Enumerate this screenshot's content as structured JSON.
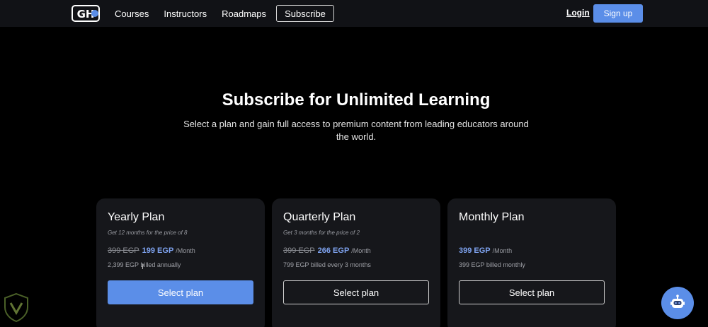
{
  "nav": {
    "logo_text": "GH",
    "links": [
      "Courses",
      "Instructors",
      "Roadmaps"
    ],
    "subscribe_label": "Subscribe",
    "login_label": "Login",
    "signup_label": "Sign up"
  },
  "hero": {
    "title": "Subscribe for Unlimited Learning",
    "subtitle": "Select a plan and gain full access to premium content from leading educators around the world."
  },
  "plans": [
    {
      "title": "Yearly Plan",
      "tagline": "Get 12 months for the price of 8",
      "old_price": "399 EGP",
      "new_price": "199 EGP",
      "unit": "/Month",
      "billed": "2,399 EGP billed annually",
      "button": "Select plan"
    },
    {
      "title": "Quarterly Plan",
      "tagline": "Get 3 months for the price of 2",
      "old_price": "399 EGP",
      "new_price": "266 EGP",
      "unit": "/Month",
      "billed": "799 EGP billed every 3 months",
      "button": "Select plan"
    },
    {
      "title": "Monthly Plan",
      "tagline": "",
      "old_price": "",
      "new_price": "399 EGP",
      "unit": "/Month",
      "billed": "399 EGP billed monthly",
      "button": "Select plan"
    }
  ],
  "colors": {
    "accent": "#5b8ee8",
    "price_highlight": "#7ea2ee",
    "card_bg": "#16171b",
    "nav_bg": "#111216",
    "page_bg": "#000000"
  },
  "icons": {
    "logo": "gh-logo-icon",
    "chat": "robot-chat-icon",
    "watermark": "shield-watermark-icon",
    "cursor": "text-cursor-icon"
  }
}
